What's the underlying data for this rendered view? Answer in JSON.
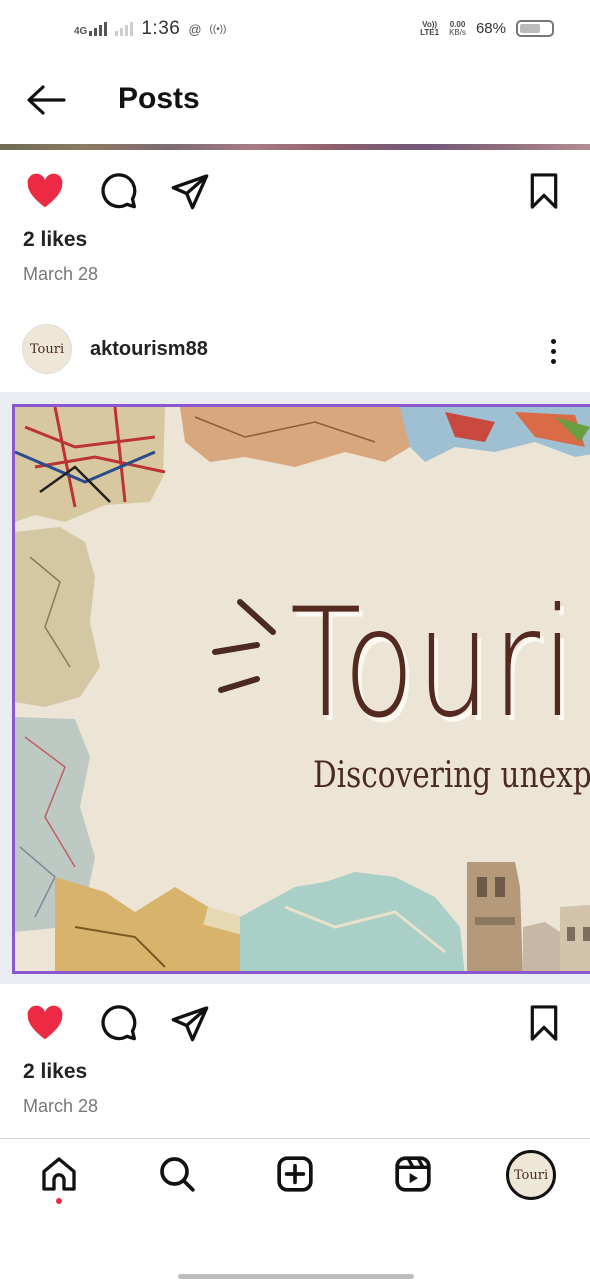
{
  "status_bar": {
    "network": "4G",
    "time": "1:36",
    "threads_glyph": "@",
    "hotspot_glyph": "((•))",
    "volte_line1": "Vo))",
    "volte_line2": "LTE1",
    "speed_value": "0.00",
    "speed_unit": "KB/s",
    "battery_percent": "68%",
    "battery_level": 0.68
  },
  "header": {
    "title": "Posts",
    "back_icon": "arrow-left-icon"
  },
  "previous_post": {
    "likes": "2 likes",
    "date": "March 28"
  },
  "post": {
    "username": "aktourism88",
    "avatar_text": "Touri",
    "image": {
      "title": "Touri",
      "subtitle": "Discovering unexplore"
    },
    "likes": "2 likes",
    "date": "March 28"
  },
  "actions": {
    "like_icon": "heart-filled-icon",
    "comment_icon": "comment-icon",
    "share_icon": "send-icon",
    "save_icon": "bookmark-icon",
    "like_color": "#ed2a44"
  },
  "bottom_nav": {
    "items": [
      "home-icon",
      "search-icon",
      "create-icon",
      "reels-icon",
      "profile-avatar"
    ],
    "profile_avatar_text": "Touri",
    "notification_dot_color": "#ed2a44"
  }
}
